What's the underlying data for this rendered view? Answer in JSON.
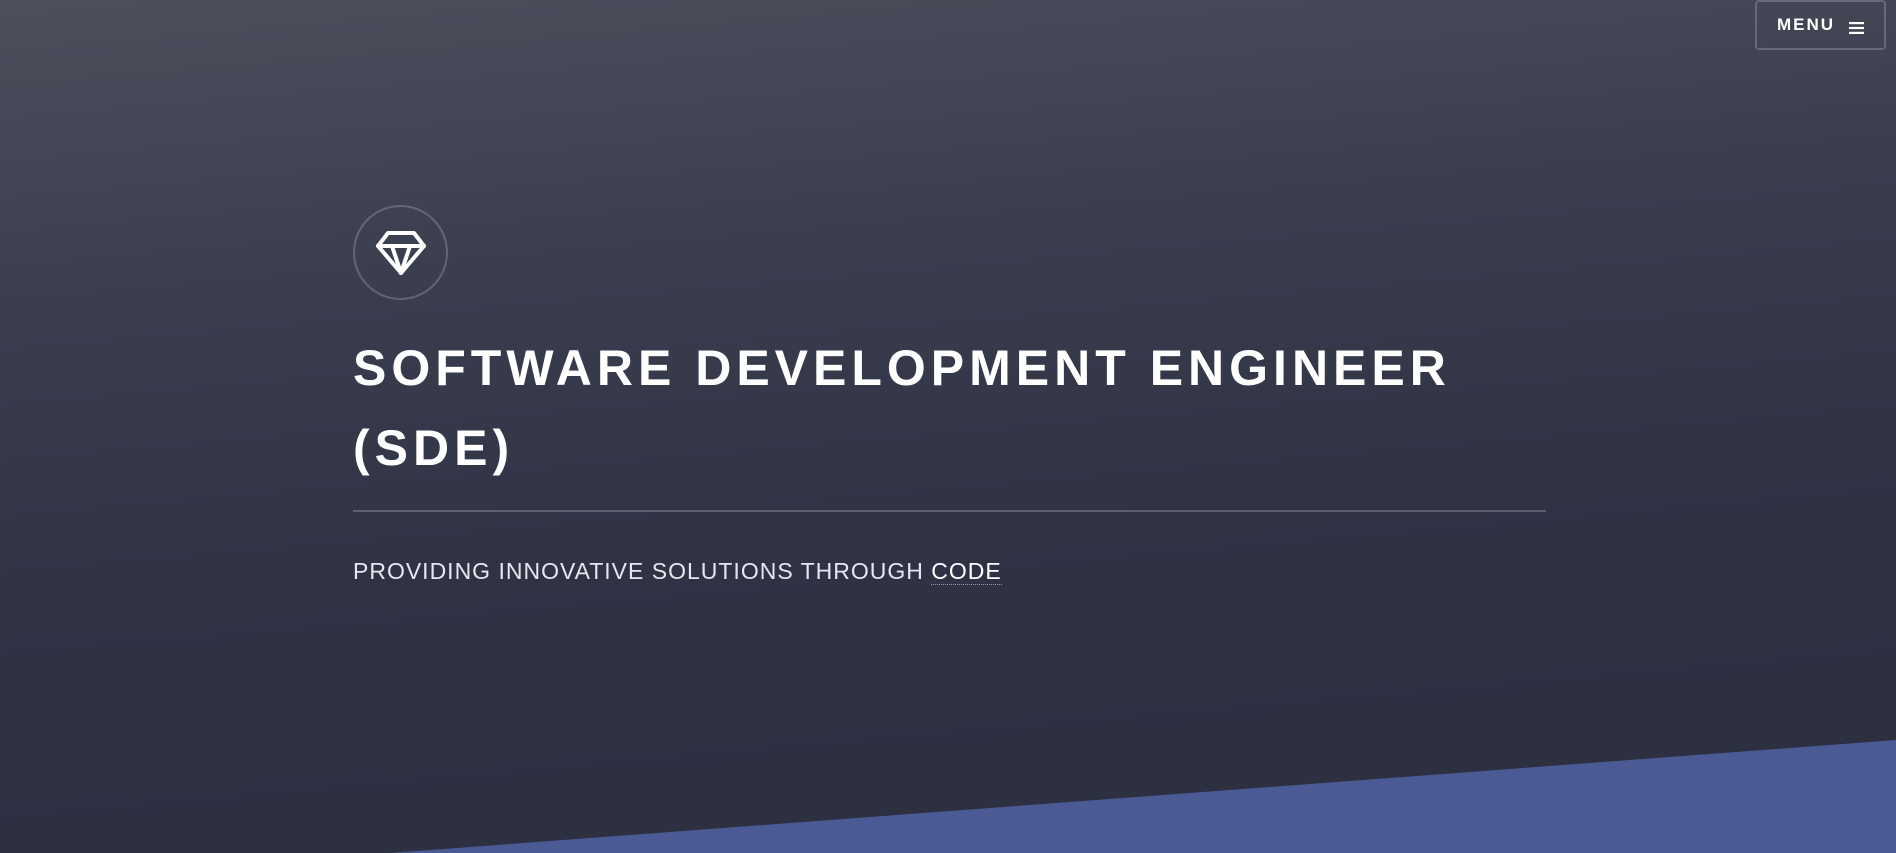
{
  "header": {
    "menu_label": "MENU",
    "menu_icon": "hamburger-icon"
  },
  "hero": {
    "logo_icon": "diamond-icon",
    "title": "SOFTWARE DEVELOPMENT ENGINEER (SDE)",
    "tagline_prefix": "PROVIDING INNOVATIVE SOLUTIONS THROUGH ",
    "tagline_link": "CODE"
  },
  "colors": {
    "background_top": "#4c505c",
    "background_bottom": "#2a2e3f",
    "accent": "#4b5994",
    "text": "#ffffff"
  }
}
